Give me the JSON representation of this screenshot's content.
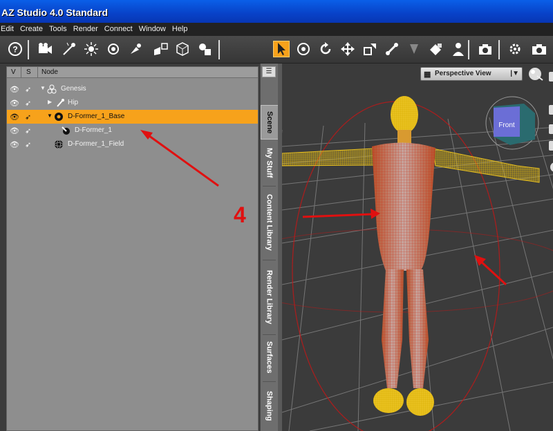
{
  "app": {
    "title": "AZ Studio 4.0 Standard"
  },
  "menu": [
    "Edit",
    "Create",
    "Tools",
    "Render",
    "Connect",
    "Window",
    "Help"
  ],
  "scene": {
    "columns": {
      "visible": "V",
      "selectable": "S",
      "node": "Node"
    },
    "rows": [
      {
        "label": "Genesis",
        "expander": "▼",
        "icon": "figure-icon",
        "selected": false
      },
      {
        "label": "Hip",
        "expander": "▶",
        "icon": "bone-icon",
        "selected": false
      },
      {
        "label": "D-Former_1_Base",
        "expander": "▼",
        "icon": "dformer-base-icon",
        "selected": true
      },
      {
        "label": "D-Former_1",
        "expander": "",
        "icon": "dformer-icon",
        "selected": false
      },
      {
        "label": "D-Former_1_Field",
        "expander": "",
        "icon": "field-sphere-icon",
        "selected": false
      }
    ]
  },
  "annotation": {
    "number": "4",
    "color": "#e01010"
  },
  "tabs": [
    "Scene",
    "My Stuff",
    "Content Library",
    "Render Library",
    "Surfaces",
    "Shaping"
  ],
  "viewport": {
    "camera_label": "Perspective View",
    "cube_face": "Front"
  },
  "colors": {
    "selection": "#f7a21b",
    "title_bar": "#0842c8",
    "figure_wireframe": "#e8c020",
    "field_wireframe": "#d01a1a"
  }
}
